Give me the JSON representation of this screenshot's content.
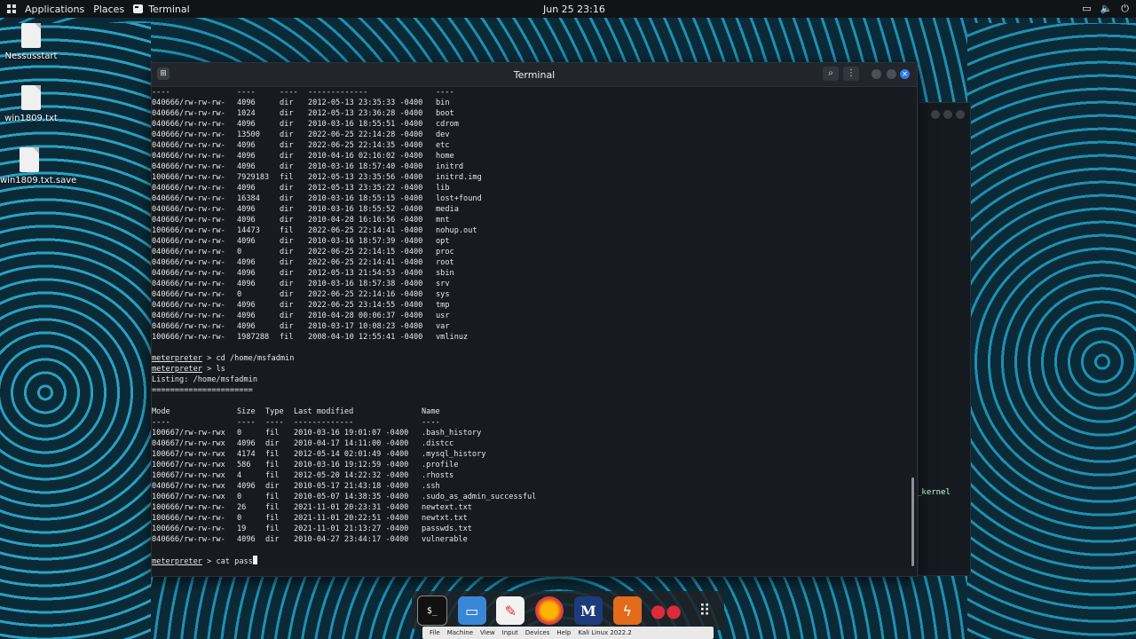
{
  "topbar": {
    "applications": "Applications",
    "places": "Places",
    "terminal": "Terminal",
    "clock": "Jun 25  23:16"
  },
  "desktop": {
    "icons": [
      {
        "label": "Nessusstart"
      },
      {
        "label": "win1809.txt"
      },
      {
        "label": "win1809.txt.save"
      }
    ]
  },
  "window": {
    "title": "Terminal"
  },
  "terminal": {
    "root_listing": [
      {
        "mode": "040666/rw-rw-rw-",
        "size": "4096",
        "type": "dir",
        "modified": "2012-05-13 23:35:33 -0400",
        "name": "bin"
      },
      {
        "mode": "040666/rw-rw-rw-",
        "size": "1024",
        "type": "dir",
        "modified": "2012-05-13 23:36:28 -0400",
        "name": "boot"
      },
      {
        "mode": "040666/rw-rw-rw-",
        "size": "4096",
        "type": "dir",
        "modified": "2010-03-16 18:55:51 -0400",
        "name": "cdrom"
      },
      {
        "mode": "040666/rw-rw-rw-",
        "size": "13500",
        "type": "dir",
        "modified": "2022-06-25 22:14:28 -0400",
        "name": "dev"
      },
      {
        "mode": "040666/rw-rw-rw-",
        "size": "4096",
        "type": "dir",
        "modified": "2022-06-25 22:14:35 -0400",
        "name": "etc"
      },
      {
        "mode": "040666/rw-rw-rw-",
        "size": "4096",
        "type": "dir",
        "modified": "2010-04-16 02:16:02 -0400",
        "name": "home"
      },
      {
        "mode": "040666/rw-rw-rw-",
        "size": "4096",
        "type": "dir",
        "modified": "2010-03-16 18:57:40 -0400",
        "name": "initrd"
      },
      {
        "mode": "100666/rw-rw-rw-",
        "size": "7929183",
        "type": "fil",
        "modified": "2012-05-13 23:35:56 -0400",
        "name": "initrd.img"
      },
      {
        "mode": "040666/rw-rw-rw-",
        "size": "4096",
        "type": "dir",
        "modified": "2012-05-13 23:35:22 -0400",
        "name": "lib"
      },
      {
        "mode": "040666/rw-rw-rw-",
        "size": "16384",
        "type": "dir",
        "modified": "2010-03-16 18:55:15 -0400",
        "name": "lost+found"
      },
      {
        "mode": "040666/rw-rw-rw-",
        "size": "4096",
        "type": "dir",
        "modified": "2010-03-16 18:55:52 -0400",
        "name": "media"
      },
      {
        "mode": "040666/rw-rw-rw-",
        "size": "4096",
        "type": "dir",
        "modified": "2010-04-28 16:16:56 -0400",
        "name": "mnt"
      },
      {
        "mode": "100666/rw-rw-rw-",
        "size": "14473",
        "type": "fil",
        "modified": "2022-06-25 22:14:41 -0400",
        "name": "nohup.out"
      },
      {
        "mode": "040666/rw-rw-rw-",
        "size": "4096",
        "type": "dir",
        "modified": "2010-03-16 18:57:39 -0400",
        "name": "opt"
      },
      {
        "mode": "040666/rw-rw-rw-",
        "size": "0",
        "type": "dir",
        "modified": "2022-06-25 22:14:15 -0400",
        "name": "proc"
      },
      {
        "mode": "040666/rw-rw-rw-",
        "size": "4096",
        "type": "dir",
        "modified": "2022-06-25 22:14:41 -0400",
        "name": "root"
      },
      {
        "mode": "040666/rw-rw-rw-",
        "size": "4096",
        "type": "dir",
        "modified": "2012-05-13 21:54:53 -0400",
        "name": "sbin"
      },
      {
        "mode": "040666/rw-rw-rw-",
        "size": "4096",
        "type": "dir",
        "modified": "2010-03-16 18:57:38 -0400",
        "name": "srv"
      },
      {
        "mode": "040666/rw-rw-rw-",
        "size": "0",
        "type": "dir",
        "modified": "2022-06-25 22:14:16 -0400",
        "name": "sys"
      },
      {
        "mode": "040666/rw-rw-rw-",
        "size": "4096",
        "type": "dir",
        "modified": "2022-06-25 23:14:55 -0400",
        "name": "tmp"
      },
      {
        "mode": "040666/rw-rw-rw-",
        "size": "4096",
        "type": "dir",
        "modified": "2010-04-28 00:06:37 -0400",
        "name": "usr"
      },
      {
        "mode": "040666/rw-rw-rw-",
        "size": "4096",
        "type": "dir",
        "modified": "2010-03-17 10:08:23 -0400",
        "name": "var"
      },
      {
        "mode": "100666/rw-rw-rw-",
        "size": "1987288",
        "type": "fil",
        "modified": "2008-04-10 12:55:41 -0400",
        "name": "vmlinuz"
      }
    ],
    "prompt": "meterpreter",
    "cmd1": " > cd /home/msfadmin",
    "cmd2": " > ls",
    "listing_title": "Listing: /home/msfadmin",
    "listing_rule": "======================",
    "headers": {
      "mode": "Mode",
      "size": "Size",
      "type": "Type",
      "modified": "Last modified",
      "name": "Name"
    },
    "header_rules": {
      "mode": "----",
      "size": "----",
      "type": "----",
      "modified": "-------------",
      "name": "----"
    },
    "home_listing": [
      {
        "mode": "100667/rw-rw-rwx",
        "size": "0",
        "type": "fil",
        "modified": "2010-03-16 19:01:07 -0400",
        "name": ".bash_history"
      },
      {
        "mode": "040667/rw-rw-rwx",
        "size": "4096",
        "type": "dir",
        "modified": "2010-04-17 14:11:00 -0400",
        "name": ".distcc"
      },
      {
        "mode": "100667/rw-rw-rwx",
        "size": "4174",
        "type": "fil",
        "modified": "2012-05-14 02:01:49 -0400",
        "name": ".mysql_history"
      },
      {
        "mode": "100667/rw-rw-rwx",
        "size": "586",
        "type": "fil",
        "modified": "2010-03-16 19:12:59 -0400",
        "name": ".profile"
      },
      {
        "mode": "100667/rw-rw-rwx",
        "size": "4",
        "type": "fil",
        "modified": "2012-05-20 14:22:32 -0400",
        "name": ".rhosts"
      },
      {
        "mode": "040667/rw-rw-rwx",
        "size": "4096",
        "type": "dir",
        "modified": "2010-05-17 21:43:18 -0400",
        "name": ".ssh"
      },
      {
        "mode": "100667/rw-rw-rwx",
        "size": "0",
        "type": "fil",
        "modified": "2010-05-07 14:38:35 -0400",
        "name": ".sudo_as_admin_successful"
      },
      {
        "mode": "100666/rw-rw-rw-",
        "size": "26",
        "type": "fil",
        "modified": "2021-11-01 20:23:31 -0400",
        "name": "newtext.txt"
      },
      {
        "mode": "100666/rw-rw-rw-",
        "size": "0",
        "type": "fil",
        "modified": "2021-11-01 20:22:51 -0400",
        "name": "newtxt.txt"
      },
      {
        "mode": "100666/rw-rw-rw-",
        "size": "19",
        "type": "fil",
        "modified": "2021-11-01 21:13:27 -0400",
        "name": "passwds.txt"
      },
      {
        "mode": "040666/rw-rw-rw-",
        "size": "4096",
        "type": "dir",
        "modified": "2010-04-27 23:44:17 -0400",
        "name": "vulnerable"
      }
    ],
    "current_input": " > cat pass"
  },
  "bg_window": {
    "fragment": "_kernel"
  },
  "vbox": {
    "items": [
      "File",
      "Machine",
      "View",
      "Input",
      "Devices",
      "Help",
      "Kali Linux 2022.2"
    ]
  }
}
